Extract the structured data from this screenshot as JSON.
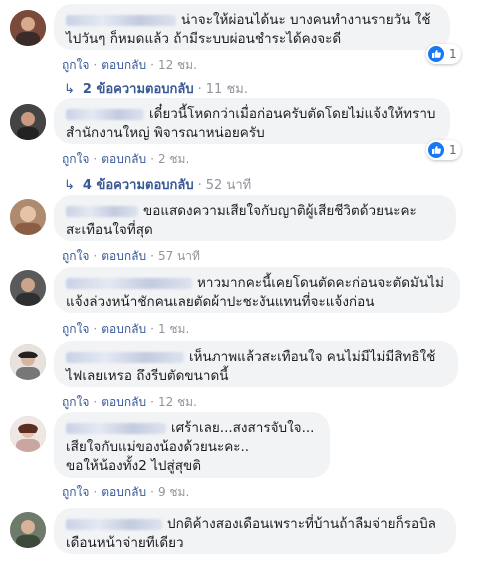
{
  "actions": {
    "like": "ถูกใจ",
    "reply": "ตอบกลับ",
    "dot": "·"
  },
  "comments": [
    {
      "text": "น่าจะให้ผ่อนได้นะ บางคนทำงานรายวัน ใช้ไปวันๆ ก็หมดแล้ว ถ้ามีระบบผ่อนชำระได้คงจะดี",
      "time": "12 ชม.",
      "reactions": "1",
      "replies": {
        "label": "2 ข้อความตอบกลับ",
        "time": "11 ชม."
      }
    },
    {
      "text": "เดี๋ยวนี้โหดกว่าเมื่อก่อนครับตัดโดยไม่แจ้งให้ทราบ สำนักงานใหญ่ พิจารณาหน่อยครับ",
      "time": "2 ชม.",
      "reactions": "1",
      "replies": {
        "label": "4 ข้อความตอบกลับ",
        "time": "52 นาที"
      }
    },
    {
      "text": "ขอแสดงความเสียใจกับญาติผู้เสียชีวิตด้วยนะคะ สะเทือนใจที่สุด",
      "time": "57 นาที"
    },
    {
      "text": "หาวมากคะนี้เคยโดนตัดคะก่อนจะตัดมันไม่แจ้งล่วงหน้าชักคนเลยตัดผ้าปะชะงันแทนที่จะแจ้งก่อน",
      "time": "1 ชม."
    },
    {
      "text": "เห็นภาพแล้วสะเทือนใจ คนไม่มีไม่มีสิทธิใช้ไฟเลยเหรอ ถึงรีบตัดขนาดนี้",
      "time": "12 ชม."
    },
    {
      "line1": "เศร้าเลย...สงสารจับใจ...",
      "line2": "เสียใจกับแม่ของน้องด้วยนะคะ..",
      "line3": "ขอให้น้องทั้ง2 ไปสู่สุขติ",
      "time": "9 ชม."
    },
    {
      "text": "ปกติค้างสองเดือนเพราะที่บ้านถ้าลืมจ่ายก็รอบิล เดือนหน้าจ่ายทีเดียว"
    }
  ],
  "icons": {
    "like": "like-icon",
    "reply_arrow": "reply-arrow-icon"
  },
  "colors": {
    "link": "#385898",
    "bubble": "#f2f3f5",
    "like": "#1877f2",
    "muted": "#90949c"
  }
}
